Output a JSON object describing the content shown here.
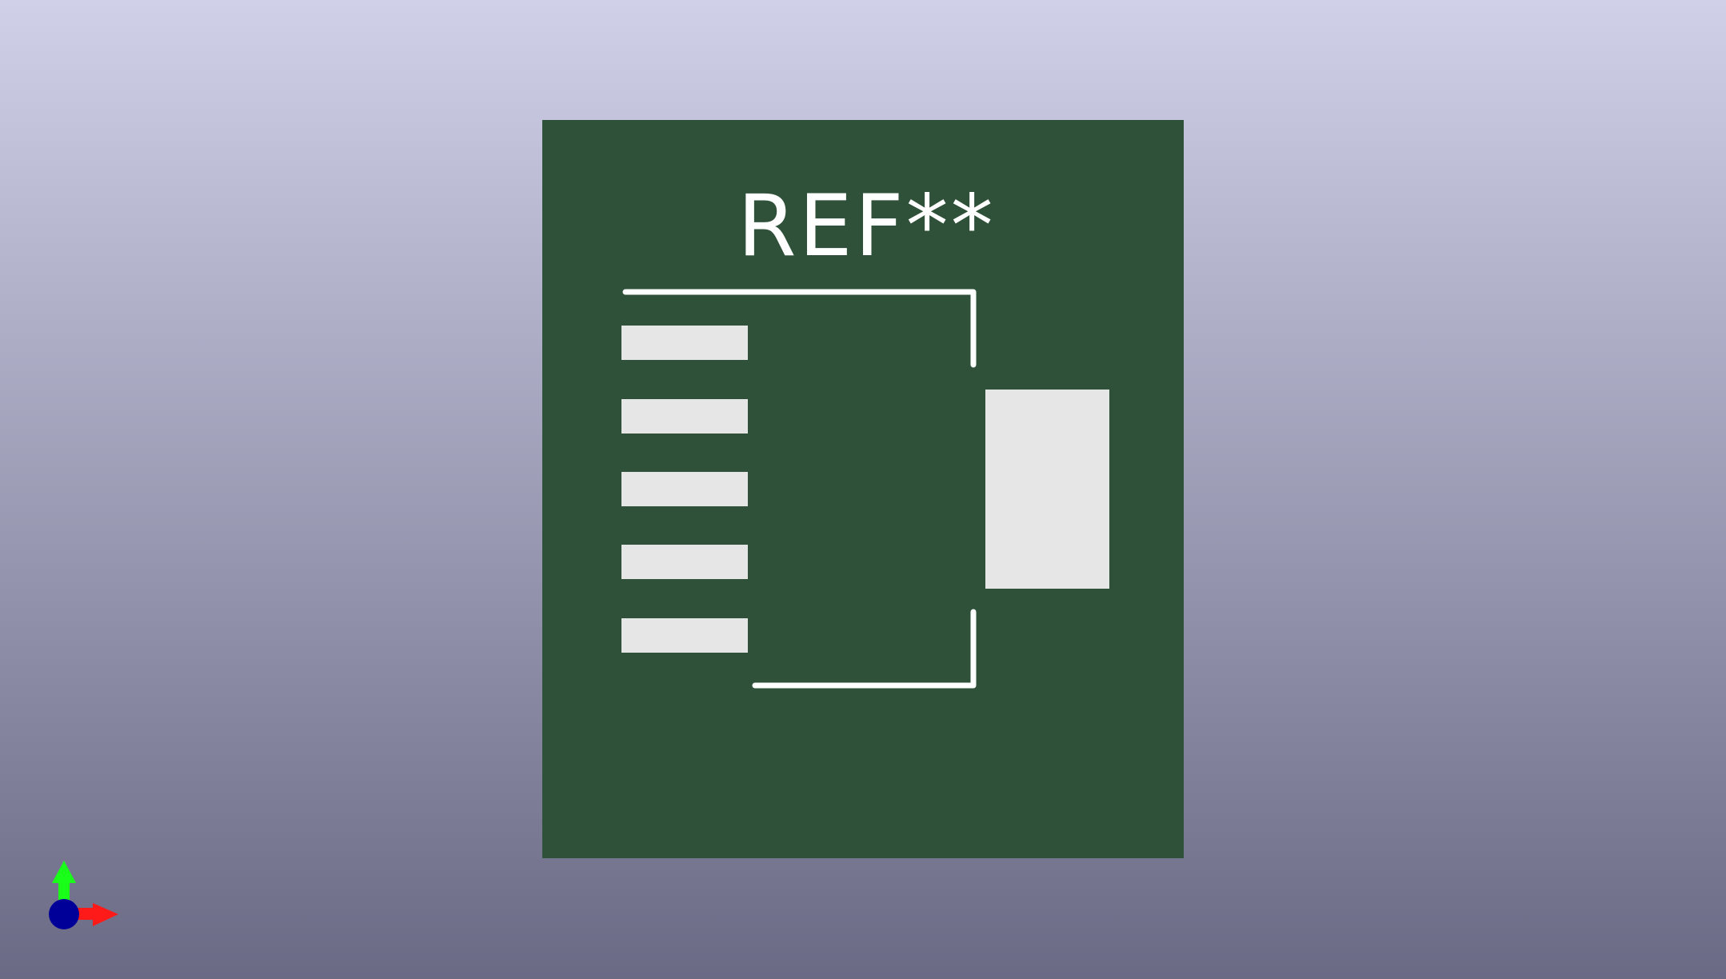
{
  "viewer": {
    "background_top": "#d0d0e8",
    "background_bottom": "#6a6a85"
  },
  "board": {
    "color": "#2f5139",
    "silkscreen_color": "#ffffff",
    "pad_color": "#e6e6e6",
    "reference_text": "REF**",
    "signal_pad_count": 5,
    "mount_pad_count": 1
  },
  "axes": {
    "x_axis_color": "#ff1a1a",
    "y_axis_color": "#1aff1a",
    "z_axis_color": "#000099"
  }
}
